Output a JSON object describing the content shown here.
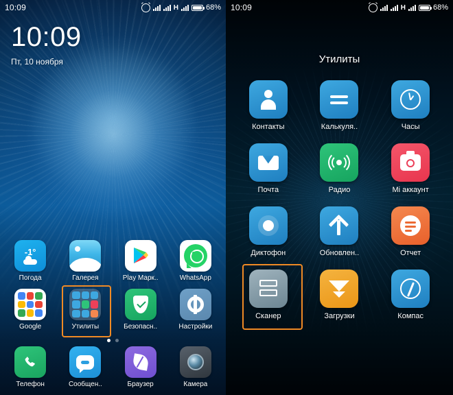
{
  "left_phone": {
    "status_bar": {
      "time": "10:09",
      "alarm_icon": "alarm-clock-icon",
      "signal_icon": "signal-bars-icon",
      "network_type": "H",
      "battery_percent": "68%"
    },
    "lock_screen": {
      "clock": "10:09",
      "date": "Пт, 10 ноября"
    },
    "apps_row1": [
      {
        "label": "Погода",
        "icon": "weather-icon",
        "value": "-1°"
      },
      {
        "label": "Галерея",
        "icon": "gallery-icon"
      },
      {
        "label": "Play Марк..",
        "icon": "play-store-icon"
      },
      {
        "label": "WhatsApp",
        "icon": "whatsapp-icon"
      }
    ],
    "apps_row2": [
      {
        "label": "Google",
        "icon": "google-folder-icon"
      },
      {
        "label": "Утилиты",
        "icon": "utilities-folder-icon"
      },
      {
        "label": "Безопасн..",
        "icon": "security-icon"
      },
      {
        "label": "Настройки",
        "icon": "settings-gear-icon"
      }
    ],
    "apps_dock": [
      {
        "label": "Телефон",
        "icon": "phone-handset-icon"
      },
      {
        "label": "Сообщен..",
        "icon": "messages-bubble-icon"
      },
      {
        "label": "Браузер",
        "icon": "browser-leaf-icon"
      },
      {
        "label": "Камера",
        "icon": "camera-lens-icon"
      }
    ],
    "page_dots": {
      "count": 2,
      "active_index": 0
    },
    "highlight_target": "Утилиты",
    "highlight_color": "#f08a24"
  },
  "right_phone": {
    "status_bar": {
      "time": "10:09",
      "alarm_icon": "alarm-clock-icon",
      "signal_icon": "signal-bars-icon",
      "network_type": "H",
      "battery_percent": "68%"
    },
    "folder_title": "Утилиты",
    "apps_row1": [
      {
        "label": "Контакты",
        "icon": "contacts-person-icon"
      },
      {
        "label": "Калькуля..",
        "icon": "calculator-icon"
      },
      {
        "label": "Часы",
        "icon": "clock-icon"
      }
    ],
    "apps_row2": [
      {
        "label": "Почта",
        "icon": "mail-envelope-icon"
      },
      {
        "label": "Радио",
        "icon": "radio-waves-icon"
      },
      {
        "label": "Mi аккаунт",
        "icon": "mi-account-icon"
      }
    ],
    "apps_row3": [
      {
        "label": "Диктофон",
        "icon": "voice-recorder-icon"
      },
      {
        "label": "Обновлен..",
        "icon": "updater-arrow-up-icon"
      },
      {
        "label": "Отчет",
        "icon": "report-icon"
      }
    ],
    "apps_row4": [
      {
        "label": "Сканер",
        "icon": "scanner-icon"
      },
      {
        "label": "Загрузки",
        "icon": "downloads-icon"
      },
      {
        "label": "Компас",
        "icon": "compass-icon"
      }
    ],
    "highlight_target": "Сканер",
    "highlight_color": "#f08a24"
  }
}
